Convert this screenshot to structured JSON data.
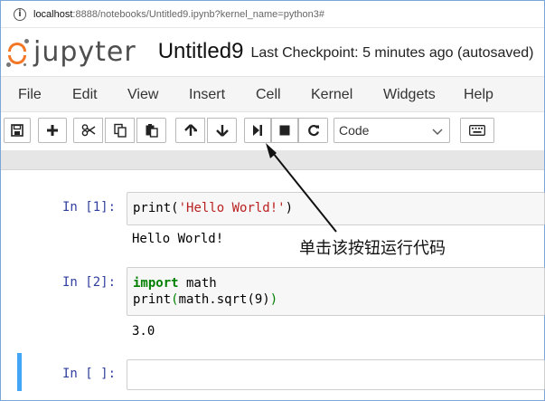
{
  "browser": {
    "url_host": "localhost",
    "url_rest": ":8888/notebooks/Untitled9.ipynb?kernel_name=python3#"
  },
  "header": {
    "logo_text": "jupyter",
    "notebook_title": "Untitled9",
    "checkpoint": "Last Checkpoint: 5 minutes ago (autosaved)"
  },
  "menu": {
    "items": [
      "File",
      "Edit",
      "View",
      "Insert",
      "Cell",
      "Kernel",
      "Widgets",
      "Help"
    ]
  },
  "toolbar": {
    "cell_type": "Code",
    "icons": [
      "save-icon",
      "plus-icon",
      "cut-icon",
      "copy-icon",
      "paste-icon",
      "arrow-up-icon",
      "arrow-down-icon",
      "run-icon",
      "stop-icon",
      "restart-icon",
      "keyboard-icon"
    ]
  },
  "cells": [
    {
      "prompt": "In [1]:",
      "code_parts": {
        "fn": "print",
        "open": "(",
        "str": "'Hello World!'",
        "close": ")"
      },
      "output": "Hello World!"
    },
    {
      "prompt": "In [2]:",
      "line1_kw": "import",
      "line1_rest": " math",
      "line2_fn": "print",
      "line2_open": "(",
      "line2_mid": "math.sqrt(9)",
      "line2_close": ")",
      "output": "3.0"
    },
    {
      "prompt": "In [ ]:"
    }
  ],
  "annotation": {
    "text": "单击该按钮运行代码"
  },
  "colors": {
    "accent": "#f37726",
    "prompt": "#303f9f",
    "selected": "#42a5f5"
  }
}
